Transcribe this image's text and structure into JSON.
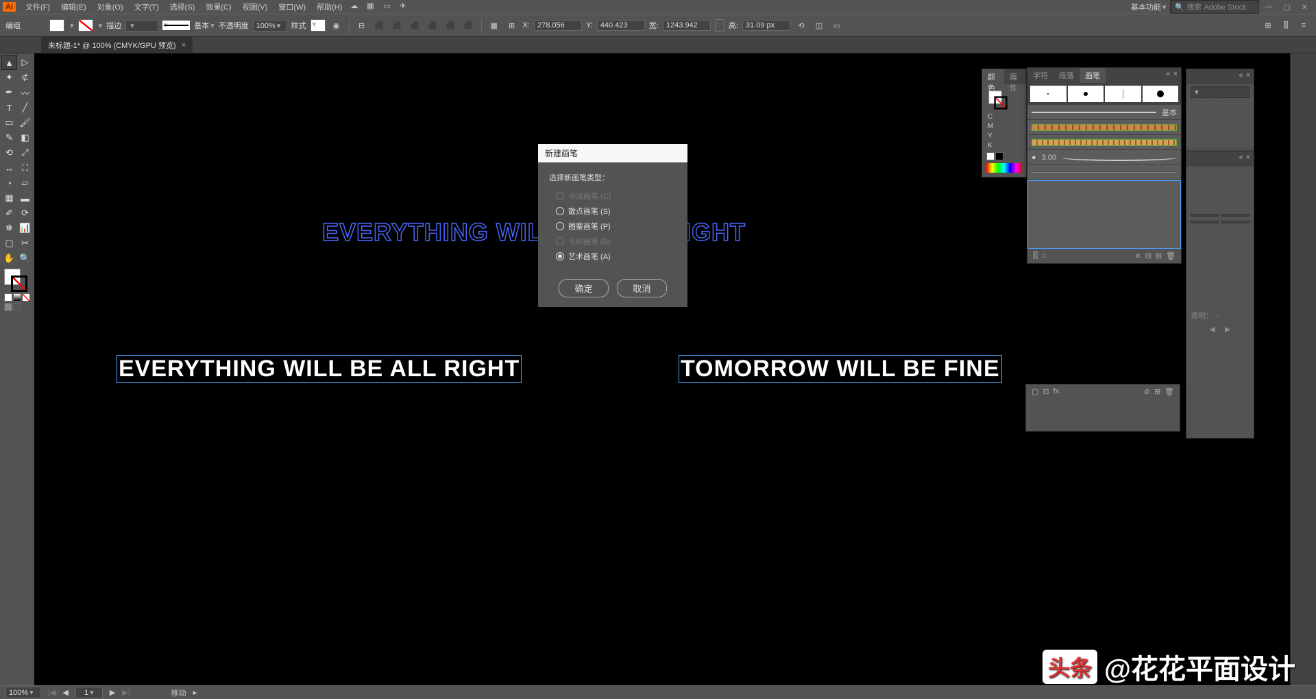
{
  "app": {
    "logo": "Ai"
  },
  "menu": {
    "items": [
      "文件(F)",
      "编辑(E)",
      "对象(O)",
      "文字(T)",
      "选择(S)",
      "效果(C)",
      "视图(V)",
      "窗口(W)",
      "帮助(H)"
    ],
    "workspace": "基本功能",
    "search_placeholder": "搜索 Adobe Stock"
  },
  "control": {
    "mode": "编组",
    "stroke_label": "描边",
    "stroke_weight": "",
    "profile": "基本",
    "opacity_label": "不透明度",
    "opacity_value": "100%",
    "style_label": "样式",
    "x_label": "X:",
    "x_value": "278.056",
    "y_label": "Y:",
    "y_value": "440.423",
    "w_label": "宽:",
    "w_value": "1243.942",
    "h_label": "高:",
    "h_value": "31.09 px"
  },
  "tab": {
    "title": "未标题-1* @ 100% (CMYK/GPU 预览)"
  },
  "canvas": {
    "text_outline": "EVERYTHING WILL BE ALL RIGHT",
    "text_solid_left": "EVERYTHING WILL BE ALL RIGHT",
    "text_solid_right": "TOMORROW WILL BE FINE"
  },
  "dialog": {
    "title": "新建画笔",
    "label": "选择新画笔类型：",
    "options": [
      {
        "label": "书法画笔 (C)",
        "disabled": true,
        "checked": false
      },
      {
        "label": "散点画笔 (S)",
        "disabled": false,
        "checked": false
      },
      {
        "label": "图案画笔 (P)",
        "disabled": false,
        "checked": false
      },
      {
        "label": "毛刷画笔 (B)",
        "disabled": true,
        "checked": false
      },
      {
        "label": "艺术画笔 (A)",
        "disabled": false,
        "checked": true
      }
    ],
    "ok": "确定",
    "cancel": "取消"
  },
  "panels": {
    "color": {
      "tabs": [
        "颜色",
        "属性"
      ],
      "channels": [
        "C",
        "M",
        "Y",
        "K"
      ]
    },
    "brush": {
      "tabs": [
        "字符",
        "段落",
        "画笔"
      ],
      "basic_label": "基本",
      "size": "3.00"
    },
    "transparency": {
      "label": "透明：",
      "value": "-"
    }
  },
  "status": {
    "zoom": "100%",
    "artboard": "1",
    "tool": "移动"
  },
  "watermark": {
    "brand": "头条",
    "author": "@花花平面设计"
  }
}
